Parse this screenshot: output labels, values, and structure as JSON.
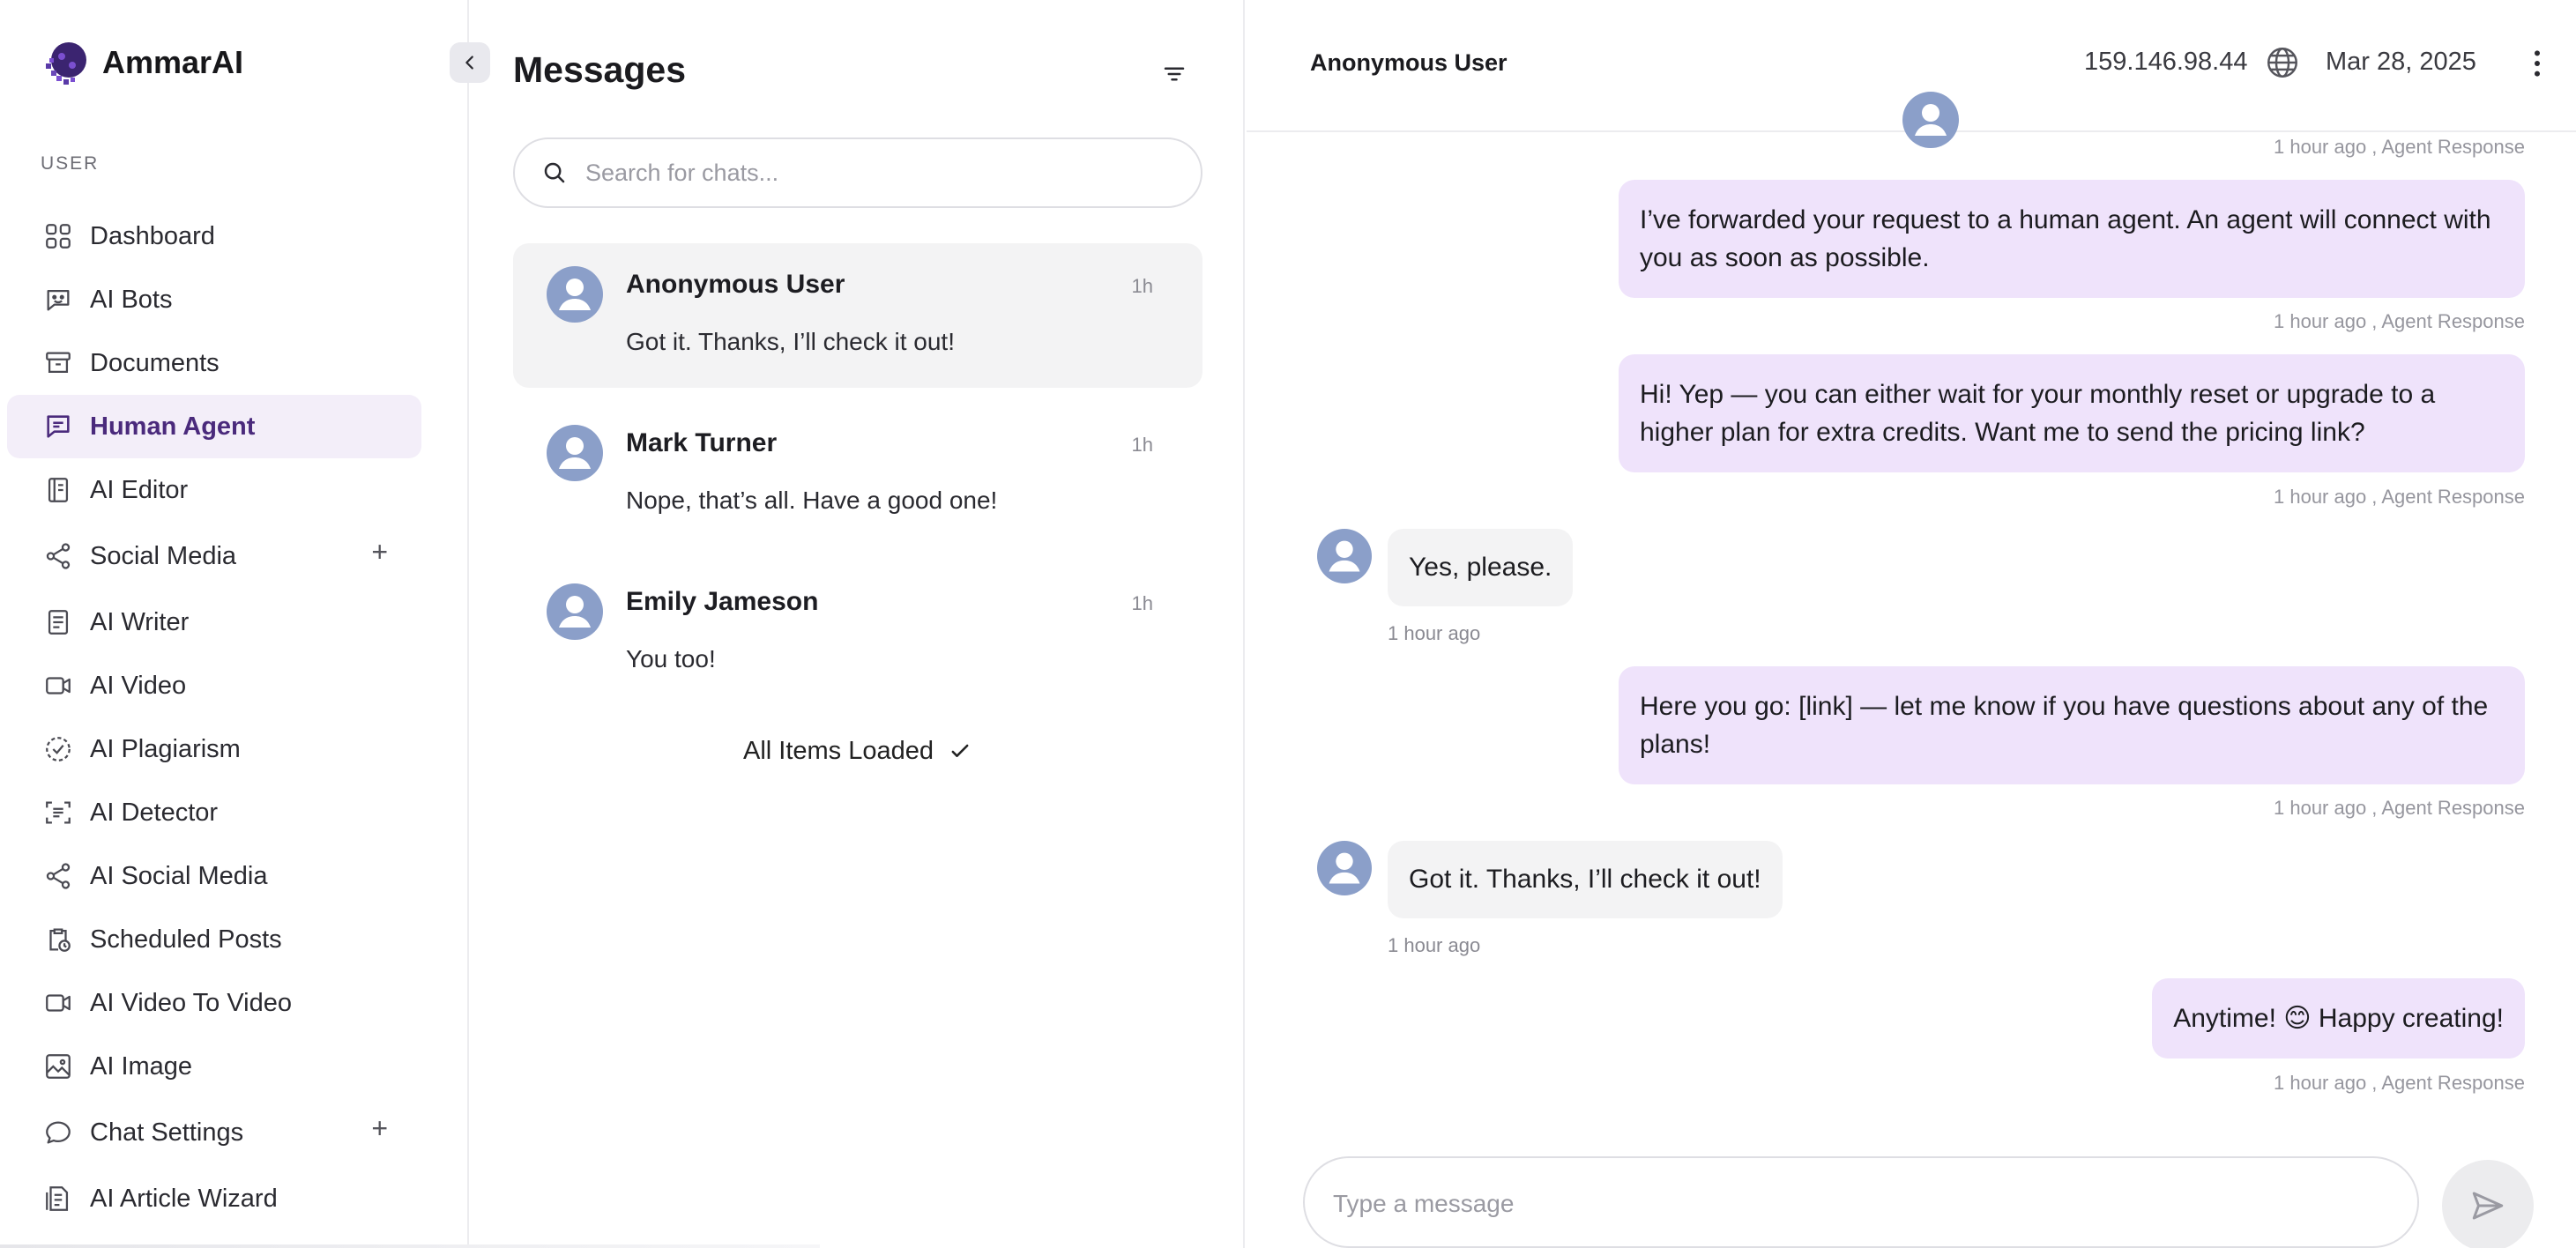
{
  "brand": {
    "name": "AmmarAI"
  },
  "sidebar": {
    "section_label": "USER",
    "items": [
      {
        "label": "Dashboard",
        "icon": "grid-icon"
      },
      {
        "label": "AI Bots",
        "icon": "bot-icon"
      },
      {
        "label": "Documents",
        "icon": "archive-icon"
      },
      {
        "label": "Human Agent",
        "icon": "chat-icon",
        "active": true
      },
      {
        "label": "AI Editor",
        "icon": "notebook-icon"
      },
      {
        "label": "Social Media",
        "icon": "share-icon",
        "expandable": true
      },
      {
        "label": "AI Writer",
        "icon": "document-icon"
      },
      {
        "label": "AI Video",
        "icon": "video-icon"
      },
      {
        "label": "AI Plagiarism",
        "icon": "check-circle-icon"
      },
      {
        "label": "AI Detector",
        "icon": "scan-icon"
      },
      {
        "label": "AI Social Media",
        "icon": "share-icon"
      },
      {
        "label": "Scheduled Posts",
        "icon": "clipboard-clock-icon"
      },
      {
        "label": "AI Video To Video",
        "icon": "video-icon"
      },
      {
        "label": "AI Image",
        "icon": "image-icon"
      },
      {
        "label": "Chat Settings",
        "icon": "chat-bubble-icon",
        "expandable": true
      },
      {
        "label": "AI Article Wizard",
        "icon": "article-icon"
      }
    ],
    "plus_symbol": "+"
  },
  "messages": {
    "title": "Messages",
    "search_placeholder": "Search for chats...",
    "chats": [
      {
        "name": "Anonymous User",
        "time": "1h",
        "preview": "Got it. Thanks, I’ll check it out!",
        "active": true
      },
      {
        "name": "Mark Turner",
        "time": "1h",
        "preview": "Nope, that’s all. Have a good one!"
      },
      {
        "name": "Emily Jameson",
        "time": "1h",
        "preview": "You too!"
      }
    ],
    "all_loaded": "All Items Loaded"
  },
  "conversation": {
    "name": "Anonymous User",
    "ip": "159.146.98.44",
    "date": "Mar 28, 2025",
    "top_meta": "1 hour ago , Agent Response",
    "messages": [
      {
        "from": "agent",
        "text": "I’ve forwarded your request to a human agent. An agent will connect with you as soon as possible.",
        "meta": "1 hour ago , Agent Response"
      },
      {
        "from": "agent",
        "text": "Hi! Yep — you can either wait for your monthly reset or upgrade to a higher plan for extra credits. Want me to send the pricing link?",
        "meta": "1 hour ago , Agent Response"
      },
      {
        "from": "user",
        "text": "Yes, please.",
        "meta": "1 hour ago"
      },
      {
        "from": "agent",
        "text": "Here you go: [link] — let me know if you have questions about any of the plans!",
        "meta": "1 hour ago , Agent Response"
      },
      {
        "from": "user",
        "text": "Got it. Thanks, I’ll check it out!",
        "meta": "1 hour ago"
      },
      {
        "from": "agent",
        "text": "Anytime! 😊 Happy creating!",
        "meta": "1 hour ago , Agent Response"
      }
    ],
    "composer_placeholder": "Type a message"
  },
  "colors": {
    "accent": "#4a2a7c",
    "active_nav_bg": "#f3eef9",
    "agent_bubble": "#efe3fb",
    "user_bubble": "#f3f3f4",
    "avatar": "#8b9fc9"
  }
}
